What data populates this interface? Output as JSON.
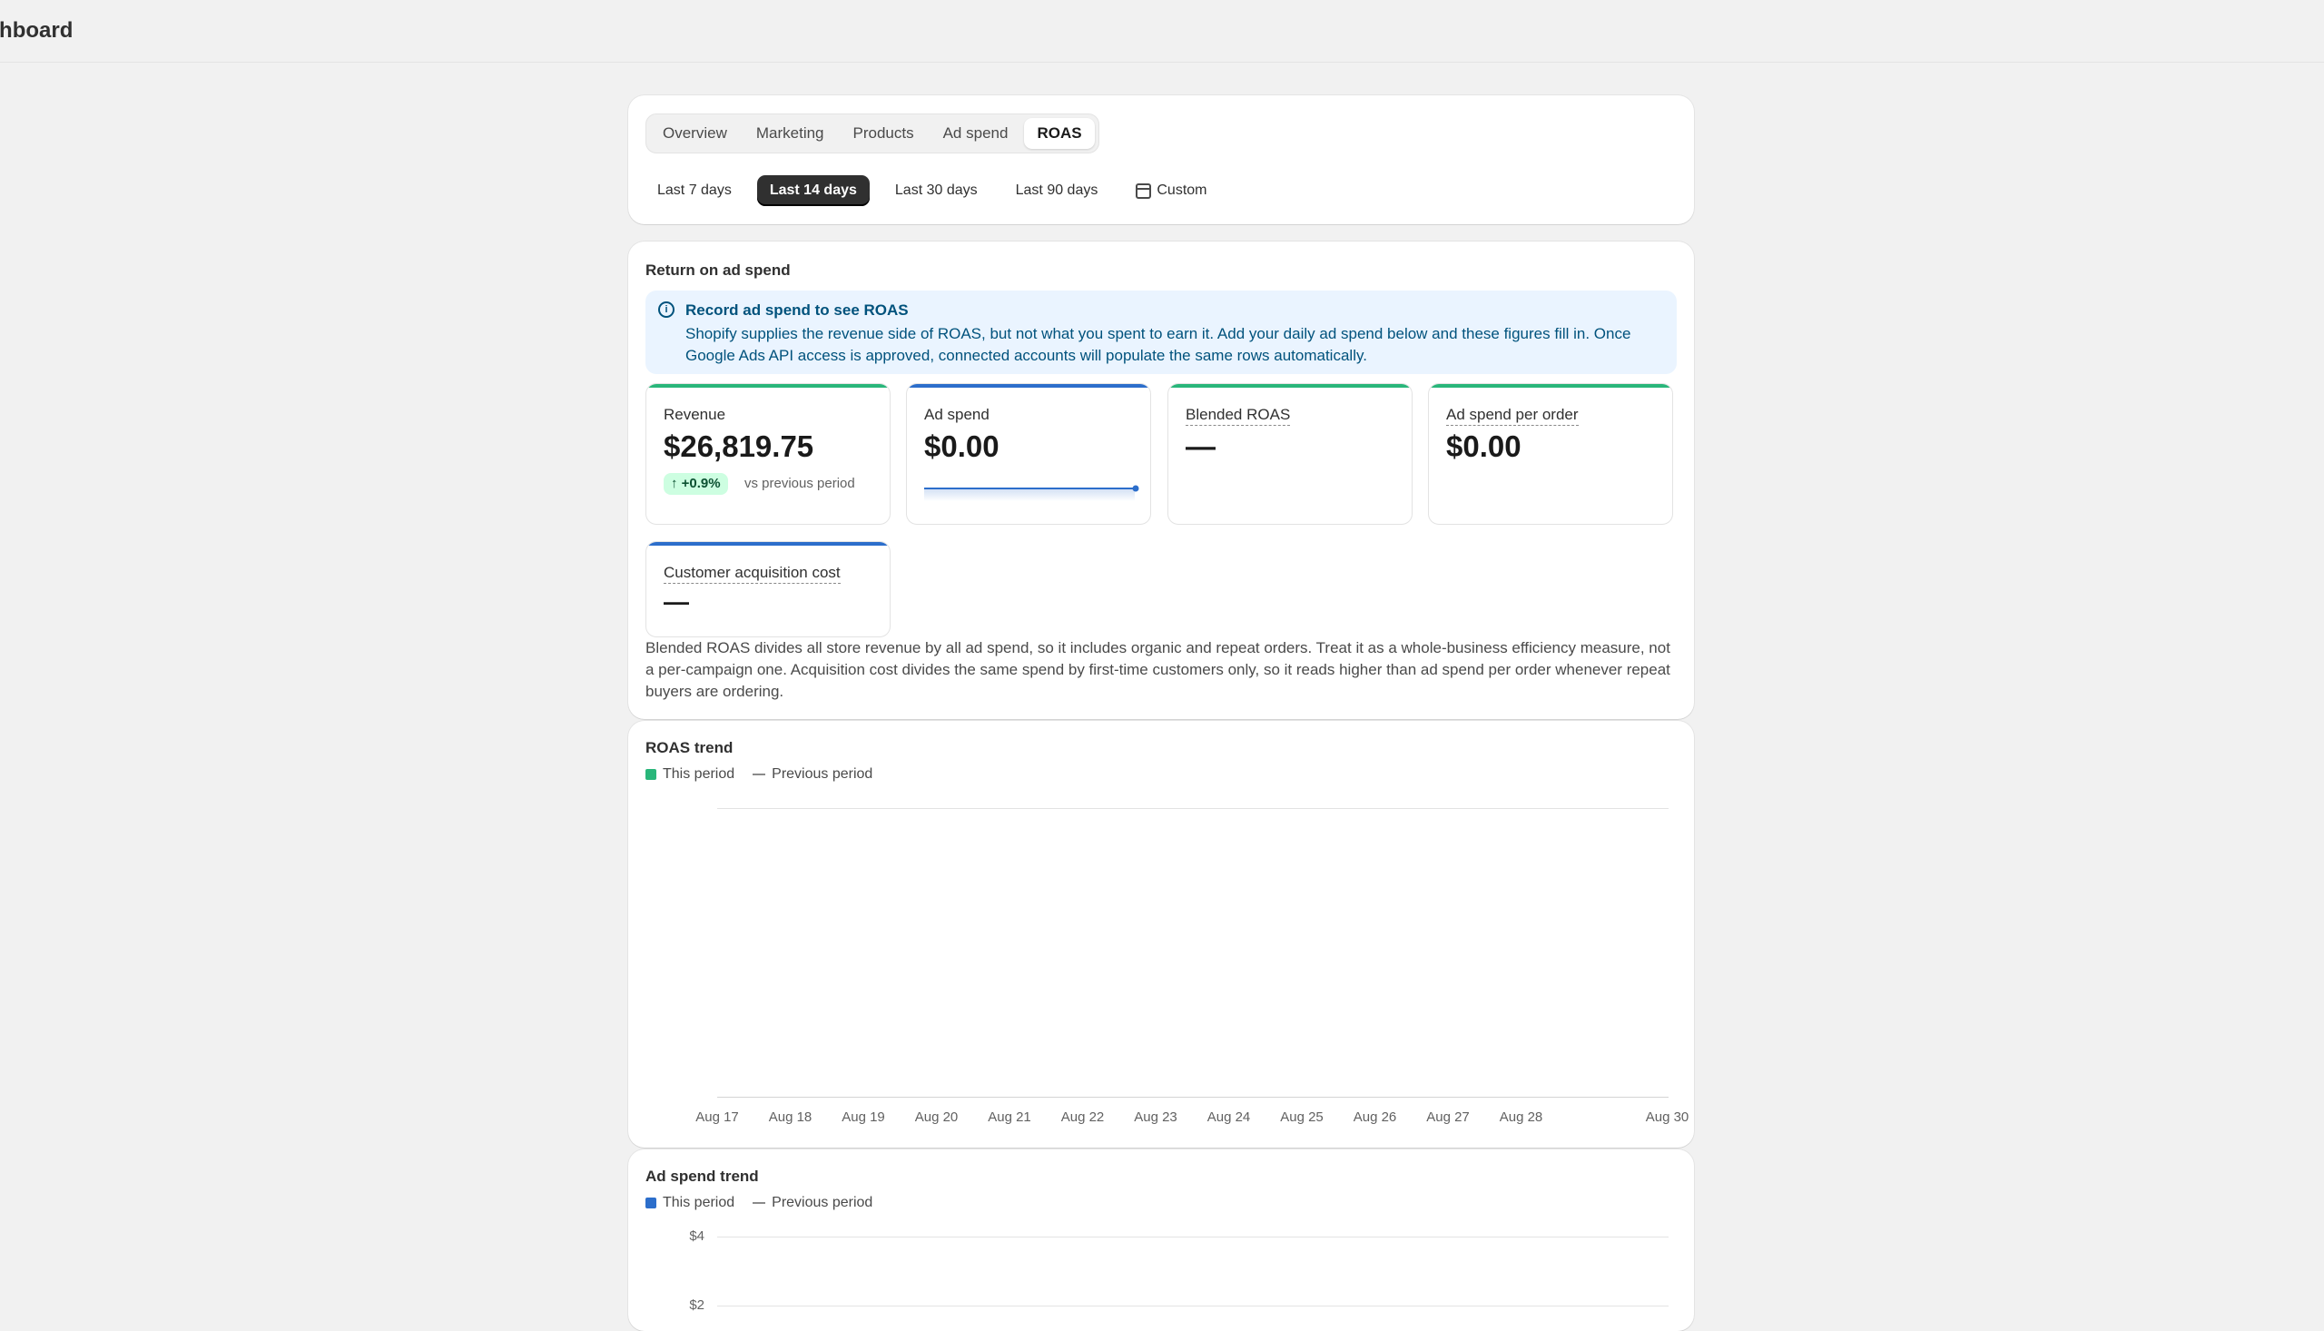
{
  "header": {
    "title": "Dashboard"
  },
  "tabs": [
    "Overview",
    "Marketing",
    "Products",
    "Ad spend",
    "ROAS"
  ],
  "active_tab": "ROAS",
  "ranges": [
    "Last 7 days",
    "Last 14 days",
    "Last 30 days",
    "Last 90 days"
  ],
  "active_range": "Last 14 days",
  "custom_label": "Custom",
  "roas_section": {
    "title": "Return on ad spend",
    "banner": {
      "title": "Record ad spend to see ROAS",
      "text": "Shopify supplies the revenue side of ROAS, but not what you spent to earn it. Add your daily ad spend below and these figures fill in. Once Google Ads API access is approved, connected accounts will populate the same rows automatically."
    },
    "metrics": {
      "revenue": {
        "label": "Revenue",
        "value": "$26,819.75",
        "change": "↑ +0.9%",
        "change_note": "vs previous period"
      },
      "ad_spend": {
        "label": "Ad spend",
        "value": "$0.00"
      },
      "blended_roas": {
        "label": "Blended ROAS",
        "value": "—"
      },
      "spend_per_order": {
        "label": "Ad spend per order",
        "value": "$0.00"
      },
      "cac": {
        "label": "Customer acquisition cost",
        "value": "—"
      }
    },
    "explanation": "Blended ROAS divides all store revenue by all ad spend, so it includes organic and repeat orders. Treat it as a whole-business efficiency measure, not a per-campaign one. Acquisition cost divides the same spend by first-time customers only, so it reads higher than ad spend per order whenever repeat buyers are ordering."
  },
  "colors": {
    "green": "#29b67a",
    "blue": "#2c6ecb",
    "grey": "#8a8a8a"
  },
  "roas_trend": {
    "title": "ROAS trend",
    "legend": {
      "this": "This period",
      "previous": "Previous period"
    }
  },
  "ad_spend_trend": {
    "title": "Ad spend trend",
    "legend": {
      "this": "This period",
      "previous": "Previous period"
    }
  },
  "chart_data": [
    {
      "type": "line",
      "title": "ROAS trend",
      "x": [
        "Aug 17",
        "Aug 18",
        "Aug 19",
        "Aug 20",
        "Aug 21",
        "Aug 22",
        "Aug 23",
        "Aug 24",
        "Aug 25",
        "Aug 26",
        "Aug 27",
        "Aug 28",
        "Aug 30"
      ],
      "series": [
        {
          "name": "This period",
          "values": []
        },
        {
          "name": "Previous period",
          "values": []
        }
      ],
      "grid": true
    },
    {
      "type": "line",
      "title": "Ad spend trend",
      "y_ticks": [
        "$4",
        "$2"
      ],
      "series": [
        {
          "name": "This period",
          "values": []
        },
        {
          "name": "Previous period",
          "values": []
        }
      ],
      "grid": true
    }
  ]
}
